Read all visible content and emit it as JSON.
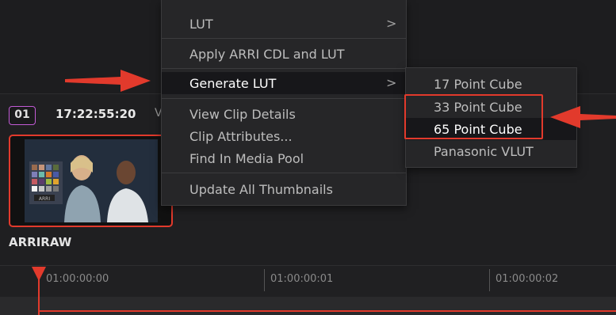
{
  "clip": {
    "badge": "01",
    "timecode": "17:22:55:20",
    "truncated_label": "V",
    "name": "ARRIRAW",
    "thumbnail_logo": "ARRI"
  },
  "context_menu": {
    "items": [
      {
        "label": "LUT",
        "has_submenu": true
      },
      {
        "label": "Apply ARRI CDL and LUT",
        "has_submenu": false
      },
      {
        "label": "Generate LUT",
        "has_submenu": true,
        "highlighted": true
      },
      {
        "label": "View Clip Details",
        "has_submenu": false
      },
      {
        "label": "Clip Attributes...",
        "has_submenu": false
      },
      {
        "label": "Find In Media Pool",
        "has_submenu": false
      },
      {
        "label": "Update All Thumbnails",
        "has_submenu": false
      }
    ],
    "chevron": ">"
  },
  "submenu": {
    "items": [
      {
        "label": "17 Point Cube"
      },
      {
        "label": "33 Point Cube"
      },
      {
        "label": "65 Point Cube",
        "highlighted": true
      },
      {
        "label": "Panasonic VLUT"
      }
    ]
  },
  "timeline": {
    "ruler_labels": [
      "01:00:00:00",
      "01:00:00:01",
      "01:00:00:02"
    ]
  },
  "colors": {
    "annotation_red": "#e23a2c",
    "clip_badge_border": "#c25bd6"
  }
}
